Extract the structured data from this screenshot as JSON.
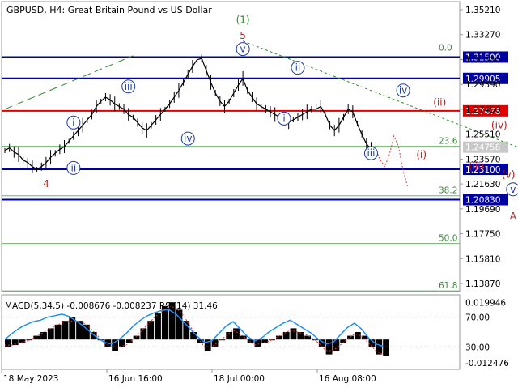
{
  "header": {
    "symbol": "GBPUSD",
    "timeframe": "H4",
    "description": "Great Britain Pound vs US Dollar"
  },
  "chart_data": {
    "type": "line",
    "price_axis": {
      "range": [
        1.1395,
        1.3565
      ],
      "ticks": [
        "1.35210",
        "1.33270",
        "1.31330",
        "1.29390",
        "1.27450",
        "1.25510",
        "1.23570",
        "1.21630",
        "1.19690",
        "1.17750",
        "1.15810",
        "1.13870"
      ]
    },
    "time_axis": {
      "labels": [
        "18 May 2023",
        "16 Jun 16:00",
        "18 Jul 00:00",
        "16 Aug 08:00"
      ],
      "label_index": [
        0,
        168,
        336,
        504
      ]
    },
    "price_series": {
      "name": "GBPUSD, H4",
      "values": [
        1.245,
        1.247,
        1.244,
        1.242,
        1.238,
        1.236,
        1.233,
        1.231,
        1.233,
        1.236,
        1.24,
        1.243,
        1.246,
        1.248,
        1.252,
        1.256,
        1.26,
        1.264,
        1.268,
        1.272,
        1.278,
        1.282,
        1.285,
        1.283,
        1.28,
        1.278,
        1.276,
        1.272,
        1.27,
        1.266,
        1.262,
        1.26,
        1.264,
        1.268,
        1.272,
        1.276,
        1.28,
        1.285,
        1.29,
        1.296,
        1.302,
        1.308,
        1.313,
        1.314,
        1.305,
        1.296,
        1.288,
        1.282,
        1.278,
        1.282,
        1.288,
        1.294,
        1.299,
        1.29,
        1.285,
        1.28,
        1.278,
        1.276,
        1.274,
        1.272,
        1.27,
        1.268,
        1.266,
        1.268,
        1.27,
        1.272,
        1.274,
        1.276,
        1.276,
        1.278,
        1.272,
        1.264,
        1.26,
        1.264,
        1.27,
        1.276,
        1.274,
        1.265,
        1.257,
        1.25,
        1.246
      ],
      "recent_projection": [
        1.246,
        1.238,
        1.233,
        1.242,
        1.256,
        1.248,
        1.23,
        1.218
      ]
    },
    "horizontal_levels": [
      {
        "price": 1.315,
        "label": "1.31500",
        "color": "#0000a0",
        "style": "solid"
      },
      {
        "price": 1.29905,
        "label": "1.29905",
        "color": "#0000a0",
        "style": "solid"
      },
      {
        "price": 1.27478,
        "label": "1.27478",
        "color": "#e00000",
        "style": "solid"
      },
      {
        "price": 1.24758,
        "label": "1.24758",
        "color": "#c8c8c8",
        "style": "current"
      },
      {
        "price": 1.231,
        "label": "1.23100",
        "color": "#0000a0",
        "style": "solid"
      },
      {
        "price": 1.2083,
        "label": "1.20830",
        "color": "#0000a0",
        "style": "solid"
      }
    ],
    "fibonacci_levels": [
      {
        "level": "0.0",
        "price": 1.318
      },
      {
        "level": "23.6",
        "price": 1.2482
      },
      {
        "level": "38.2",
        "price": 1.2112
      },
      {
        "level": "50.0",
        "price": 1.1755
      },
      {
        "level": "61.8",
        "price": 1.14
      }
    ],
    "wave_labels": [
      {
        "text": "(1)",
        "color": "#2e8b2e",
        "circled": false,
        "at": 52,
        "price": 1.343
      },
      {
        "text": "5",
        "color": "#a52a2a",
        "circled": false,
        "at": 52,
        "price": 1.331
      },
      {
        "text": "v",
        "color": "#1e3caa",
        "circled": true,
        "at": 52,
        "price": 1.321
      },
      {
        "text": "4",
        "color": "#a52a2a",
        "circled": false,
        "at": 9,
        "price": 1.22
      },
      {
        "text": "i",
        "color": "#1e3caa",
        "circled": true,
        "at": 15,
        "price": 1.266
      },
      {
        "text": "ii",
        "color": "#1e3caa",
        "circled": true,
        "at": 15,
        "price": 1.232
      },
      {
        "text": "iii",
        "color": "#1e3caa",
        "circled": true,
        "at": 27,
        "price": 1.293
      },
      {
        "text": "iv",
        "color": "#1e3caa",
        "circled": true,
        "at": 40,
        "price": 1.254
      },
      {
        "text": "ii",
        "color": "#1e3caa",
        "circled": true,
        "at": 64,
        "price": 1.307
      },
      {
        "text": "i",
        "color": "#1e3caa",
        "circled": true,
        "at": 61,
        "price": 1.269
      },
      {
        "text": "iii",
        "color": "#1e3caa",
        "circled": true,
        "at": 80,
        "price": 1.243
      },
      {
        "text": "iv",
        "color": "#1e3caa",
        "circled": true,
        "at": 87,
        "price": 1.29
      },
      {
        "text": "(ii)",
        "color": "#cc1111",
        "circled": false,
        "at": 95,
        "price": 1.281
      },
      {
        "text": "(i)",
        "color": "#cc1111",
        "circled": false,
        "at": 91,
        "price": 1.242
      },
      {
        "text": "(iv)",
        "color": "#cc1111",
        "circled": false,
        "at": 108,
        "price": 1.264
      },
      {
        "text": "(iii)",
        "color": "#cc1111",
        "circled": false,
        "at": 103,
        "price": 1.233
      },
      {
        "text": "(v)",
        "color": "#cc1111",
        "circled": false,
        "at": 110,
        "price": 1.227
      },
      {
        "text": "v",
        "color": "#1e3caa",
        "circled": true,
        "at": 111,
        "price": 1.216
      },
      {
        "text": "A",
        "color": "#a52a2a",
        "circled": false,
        "at": 111,
        "price": 1.196
      }
    ],
    "trend_lines": [
      {
        "color": "#2e8b2e",
        "style": "long-dash",
        "from": {
          "at": 0,
          "price": 1.276
        },
        "to": {
          "at": 28,
          "price": 1.316
        }
      },
      {
        "color": "#2e8b2e",
        "style": "dotted",
        "from": {
          "at": 52,
          "price": 1.327
        },
        "to": {
          "at": 120,
          "price": 1.237
        }
      }
    ],
    "indicator_panel": {
      "title": "MACD(5,34,5) -0.008676 -0.008237 RSI(14) 31.46",
      "macd_axis": {
        "ticks": [
          "0.019946",
          "-0.012476"
        ],
        "range": [
          -0.016,
          0.024
        ]
      },
      "rsi_axis": {
        "ticks": [
          "70.00",
          "30.00"
        ],
        "range": [
          0,
          100
        ]
      },
      "macd_histogram": [
        -0.004,
        -0.003,
        -0.002,
        0.0,
        0.002,
        0.004,
        0.006,
        0.008,
        0.01,
        0.012,
        0.01,
        0.008,
        0.004,
        0.0,
        -0.004,
        -0.006,
        -0.004,
        -0.002,
        0.002,
        0.006,
        0.01,
        0.014,
        0.018,
        0.02,
        0.016,
        0.01,
        0.004,
        -0.002,
        -0.006,
        -0.004,
        0.0,
        0.004,
        0.006,
        0.002,
        -0.002,
        -0.004,
        -0.002,
        0.0,
        0.002,
        0.004,
        0.006,
        0.004,
        0.002,
        0.0,
        -0.004,
        -0.008,
        -0.006,
        -0.002,
        0.002,
        0.004,
        0.002,
        -0.004,
        -0.008,
        -0.009
      ],
      "macd_signal": [
        -0.003,
        -0.003,
        -0.002,
        -0.001,
        0.001,
        0.003,
        0.005,
        0.007,
        0.009,
        0.01,
        0.01,
        0.009,
        0.006,
        0.002,
        -0.002,
        -0.004,
        -0.004,
        -0.003,
        0.0,
        0.004,
        0.008,
        0.012,
        0.015,
        0.018,
        0.017,
        0.013,
        0.007,
        0.001,
        -0.004,
        -0.004,
        -0.001,
        0.002,
        0.005,
        0.003,
        0.0,
        -0.003,
        -0.002,
        -0.001,
        0.001,
        0.003,
        0.005,
        0.004,
        0.003,
        0.001,
        -0.002,
        -0.006,
        -0.006,
        -0.003,
        0.0,
        0.003,
        0.002,
        -0.002,
        -0.006,
        -0.008
      ],
      "rsi": [
        40,
        48,
        55,
        60,
        64,
        66,
        70,
        72,
        74,
        71,
        65,
        58,
        50,
        42,
        36,
        34,
        40,
        48,
        58,
        66,
        72,
        76,
        79,
        80,
        74,
        64,
        54,
        44,
        36,
        38,
        48,
        58,
        64,
        54,
        44,
        38,
        42,
        50,
        56,
        62,
        66,
        60,
        54,
        48,
        40,
        34,
        36,
        46,
        56,
        62,
        54,
        42,
        34,
        31
      ]
    }
  }
}
